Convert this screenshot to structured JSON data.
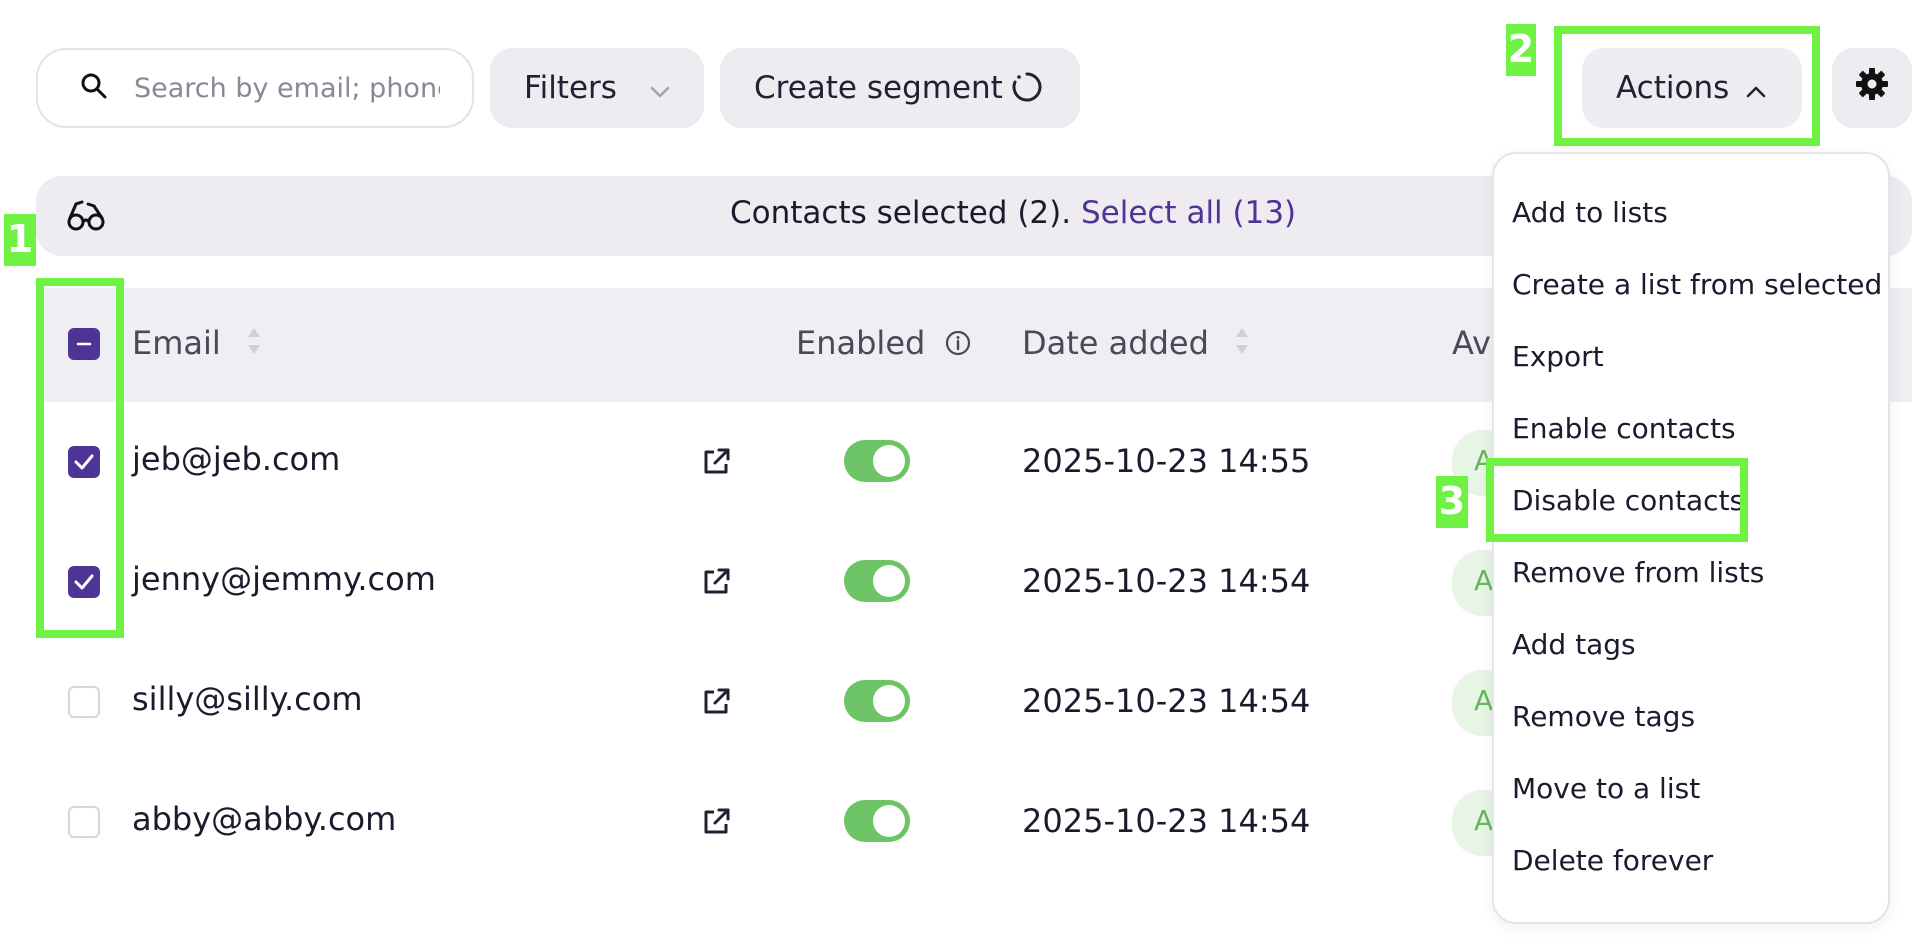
{
  "toolbar": {
    "search_placeholder": "Search by email; phone;",
    "filters_label": "Filters",
    "create_segment_label": "Create segment",
    "actions_label": "Actions"
  },
  "selection_bar": {
    "message": "Contacts selected (2).",
    "select_all": "Select all (13)"
  },
  "table": {
    "columns": {
      "email": "Email",
      "enabled": "Enabled",
      "date_added": "Date added",
      "availability": "Av"
    },
    "rows": [
      {
        "email": "jeb@jeb.com",
        "checked": true,
        "enabled": true,
        "date": "2025-10-23 14:55",
        "badge": "A"
      },
      {
        "email": "jenny@jemmy.com",
        "checked": true,
        "enabled": true,
        "date": "2025-10-23 14:54",
        "badge": "A"
      },
      {
        "email": "silly@silly.com",
        "checked": false,
        "enabled": true,
        "date": "2025-10-23 14:54",
        "badge": "A"
      },
      {
        "email": "abby@abby.com",
        "checked": false,
        "enabled": true,
        "date": "2025-10-23 14:54",
        "badge": "A"
      }
    ]
  },
  "actions_menu": {
    "items": [
      "Add to lists",
      "Create a list from selected",
      "Export",
      "Enable contacts",
      "Disable contacts",
      "Remove from lists",
      "Add tags",
      "Remove tags",
      "Move to a list",
      "Delete forever"
    ]
  },
  "annotations": {
    "step1": "1",
    "step2": "2",
    "step3": "3"
  },
  "colors": {
    "accent": "#4e3494",
    "toggle_on": "#6cc466",
    "highlight": "#6ff244"
  },
  "icons": [
    "search-icon",
    "chevron-down-icon",
    "refresh-icon",
    "chevron-up-icon",
    "gear-icon",
    "glasses-icon",
    "sort-icon",
    "info-icon",
    "external-link-icon"
  ]
}
